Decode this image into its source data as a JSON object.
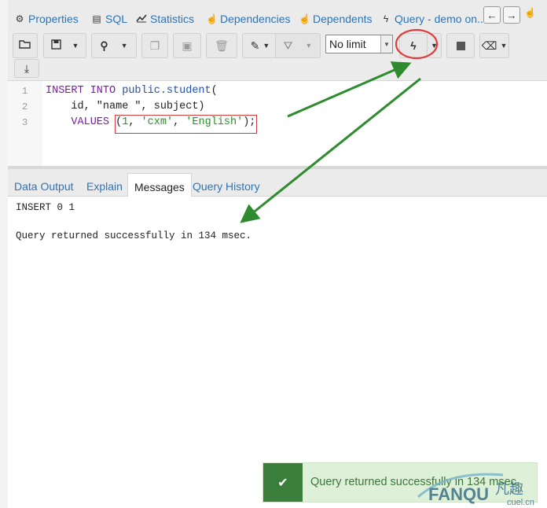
{
  "top_tabs": [
    {
      "label": "Properties",
      "icon": "gears-icon"
    },
    {
      "label": "SQL",
      "icon": "file-code-icon"
    },
    {
      "label": "Statistics",
      "icon": "chart-line-icon"
    },
    {
      "label": "Dependencies",
      "icon": "hand-pointer-icon"
    },
    {
      "label": "Dependents",
      "icon": "hand-pointer-icon"
    },
    {
      "label": "Query - demo on...",
      "icon": "bolt-icon"
    }
  ],
  "nav": {
    "back_icon": "arrow-left-icon",
    "forward_icon": "arrow-right-icon"
  },
  "toolbar": {
    "limit_value": "No limit",
    "buttons": [
      "open-file",
      "save",
      "find",
      "copy",
      "paste-row",
      "delete",
      "edit",
      "filter",
      "execute",
      "stop",
      "clear",
      "download"
    ]
  },
  "editor": {
    "line_numbers": [
      "1",
      "2",
      "3"
    ],
    "line1": {
      "kw1": "INSERT INTO ",
      "obj": "public.student",
      "rest": "("
    },
    "line2": {
      "text": "    id, \"name \", subject)"
    },
    "line3": {
      "kw": "    VALUES ",
      "open": "(",
      "num": "1",
      "sep1": ", ",
      "s1": "'cxm'",
      "sep2": ", ",
      "s2": "'English'",
      "close": ");"
    }
  },
  "result_tabs": [
    {
      "label": "Data Output",
      "active": false
    },
    {
      "label": "Explain",
      "active": false
    },
    {
      "label": "Messages",
      "active": true
    },
    {
      "label": "Query History",
      "active": false
    }
  ],
  "messages": {
    "line1": "INSERT 0 1",
    "line2": "Query returned successfully in 134 msec."
  },
  "toast": {
    "text": "Query returned successfully in 134 msec.",
    "icon": "check-icon"
  },
  "watermark": {
    "brand": "FANQU",
    "cn": "凡趣",
    "domain": "cuel.cn"
  },
  "annotation_colors": {
    "arrow": "#2e8b2e",
    "circle": "#e03a3a",
    "box": "#d23b3b"
  }
}
